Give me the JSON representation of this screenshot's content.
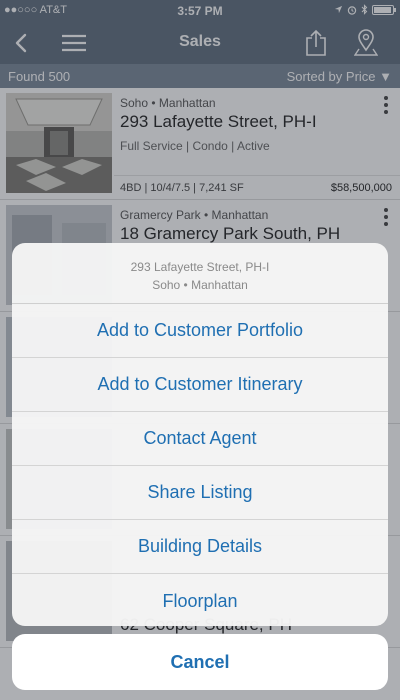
{
  "status_bar": {
    "carrier": "●●○○○ AT&T",
    "time": "3:57 PM",
    "battery_level": 0.95
  },
  "nav": {
    "title": "Sales"
  },
  "summary": {
    "found": "Found 500",
    "sorted": "Sorted by Price ▼"
  },
  "listings": [
    {
      "neighborhood": "Soho • Manhattan",
      "address": "293 Lafayette Street, PH-I",
      "tags": "Full Service | Condo | Active",
      "stats": "4BD | 10/4/7.5 | 7,241 SF",
      "price": "$58,500,000"
    },
    {
      "neighborhood": "Gramercy Park • Manhattan",
      "address": "18 Gramercy Park South, PH"
    },
    {
      "address": ""
    },
    {
      "address": ""
    },
    {
      "address": "62 Cooper Square, PH"
    }
  ],
  "action_sheet": {
    "title": "293 Lafayette Street, PH-I",
    "subtitle": "Soho • Manhattan",
    "actions": [
      "Add to Customer Portfolio",
      "Add to Customer Itinerary",
      "Contact Agent",
      "Share Listing",
      "Building Details",
      "Floorplan"
    ],
    "cancel": "Cancel"
  },
  "colors": {
    "nav_bg": "#5f6e7e",
    "summary_bg": "#7a8898",
    "action_blue": "#1f6fb2"
  }
}
